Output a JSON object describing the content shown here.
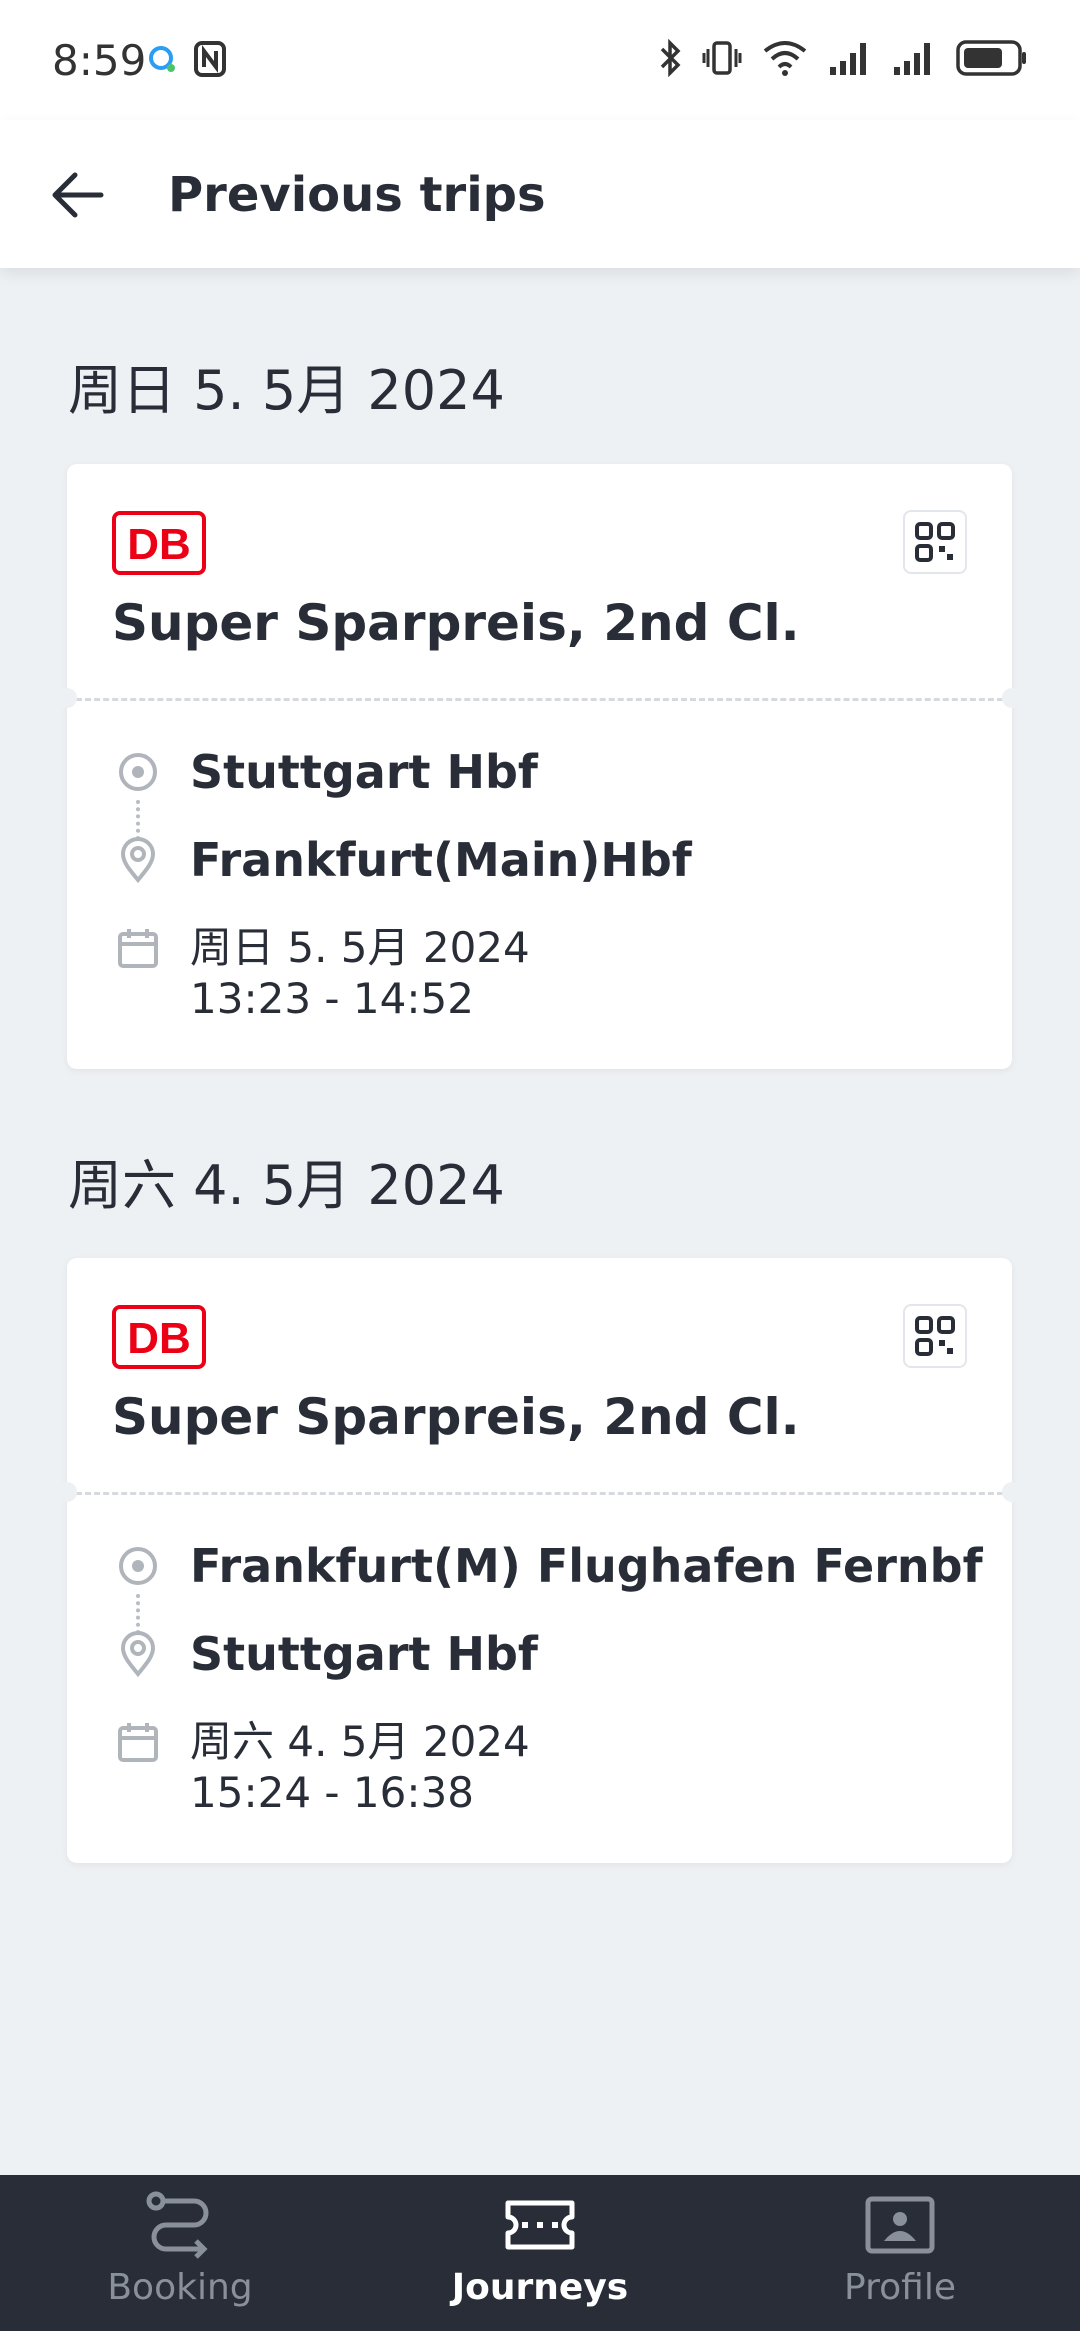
{
  "status_bar": {
    "time": "8:59"
  },
  "header": {
    "title": "Previous trips"
  },
  "trips": [
    {
      "date_heading": "周日 5. 5月 2024",
      "tariff": "Super Sparpreis, 2nd Cl.",
      "origin": "Stuttgart Hbf",
      "destination": "Frankfurt(Main)Hbf",
      "date": "周日 5. 5月 2024",
      "time": "13:23 - 14:52"
    },
    {
      "date_heading": "周六 4. 5月 2024",
      "tariff": "Super Sparpreis, 2nd Cl.",
      "origin": "Frankfurt(M) Flughafen Fernbf",
      "destination": "Stuttgart Hbf",
      "date": "周六 4. 5月 2024",
      "time": "15:24 - 16:38"
    }
  ],
  "logo": {
    "text": "DB",
    "color": "#ec0016"
  },
  "nav": {
    "items": [
      {
        "label": "Booking",
        "icon": "route-icon",
        "active": false
      },
      {
        "label": "Journeys",
        "icon": "ticket-icon",
        "active": true
      },
      {
        "label": "Profile",
        "icon": "profile-card-icon",
        "active": false
      }
    ]
  },
  "colors": {
    "background": "#eef1f4",
    "text": "#282d37",
    "nav_background": "#282d37",
    "db_red": "#ec0016"
  }
}
